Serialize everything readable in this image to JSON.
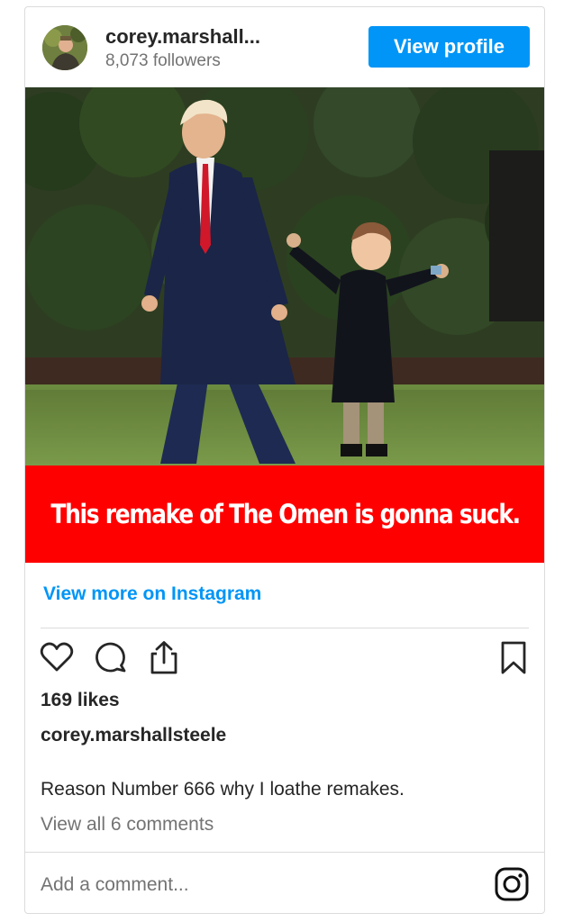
{
  "header": {
    "username": "corey.marshall...",
    "followers": "8,073 followers",
    "view_profile_label": "View profile",
    "avatar_icon": "user-avatar"
  },
  "media": {
    "image_description_icon": "photo",
    "caption_text": "This remake of The Omen is gonna suck.",
    "banner_color": "#ff0000"
  },
  "links": {
    "view_more": "View more on Instagram"
  },
  "actions": {
    "like_icon": "heart-icon",
    "comment_icon": "comment-icon",
    "share_icon": "share-icon",
    "save_icon": "bookmark-icon"
  },
  "post": {
    "likes": "169 likes",
    "author": "corey.marshallsteele",
    "caption": "Reason Number 666 why I loathe remakes.",
    "view_comments": "View all 6 comments"
  },
  "footer": {
    "add_comment_placeholder": "Add a comment...",
    "instagram_icon": "instagram-icon"
  },
  "colors": {
    "accent": "#0095f6",
    "text": "#262626",
    "muted": "#737373"
  }
}
